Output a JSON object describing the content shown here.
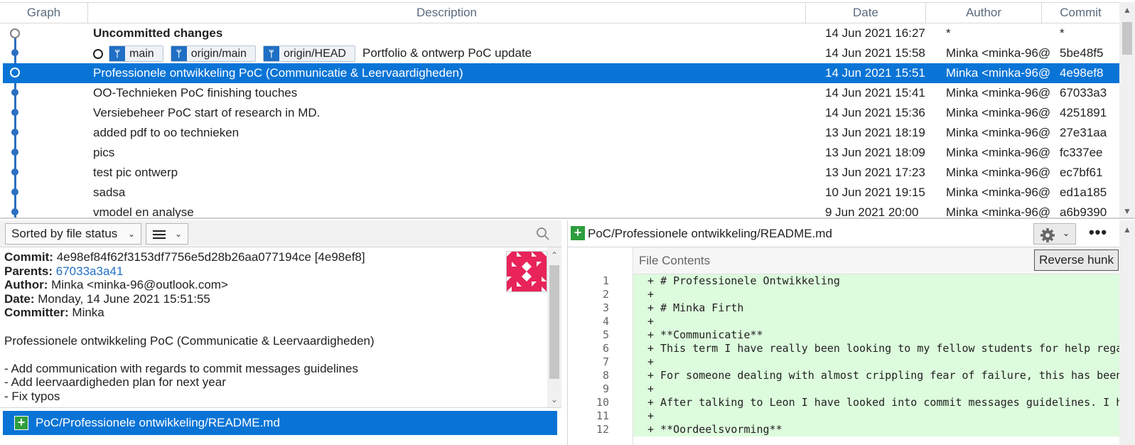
{
  "table": {
    "columns": [
      "Graph",
      "Description",
      "Date",
      "Author",
      "Commit"
    ],
    "commits": [
      {
        "description": "Uncommitted changes",
        "date": "14 Jun 2021 16:27",
        "author": "*",
        "commit": "*"
      },
      {
        "refs": [
          "main",
          "origin/main",
          "origin/HEAD"
        ],
        "description": "Portfolio & ontwerp PoC update",
        "date": "14 Jun 2021 15:58",
        "author": "Minka <minka-96@",
        "commit": "5be48f5"
      },
      {
        "description": "Professionele ontwikkeling PoC (Communicatie & Leervaardigheden)",
        "date": "14 Jun 2021 15:51",
        "author": "Minka <minka-96@",
        "commit": "4e98ef8"
      },
      {
        "description": "OO-Technieken PoC finishing touches",
        "date": "14 Jun 2021 15:41",
        "author": "Minka <minka-96@",
        "commit": "67033a3"
      },
      {
        "description": "Versiebeheer PoC start of research in MD.",
        "date": "14 Jun 2021 15:36",
        "author": "Minka <minka-96@",
        "commit": "4251891"
      },
      {
        "description": "added pdf to oo technieken",
        "date": "13 Jun 2021 18:19",
        "author": "Minka <minka-96@",
        "commit": "27e31aa"
      },
      {
        "description": "pics",
        "date": "13 Jun 2021 18:09",
        "author": "Minka <minka-96@",
        "commit": "fc337ee"
      },
      {
        "description": "test pic ontwerp",
        "date": "13 Jun 2021 17:23",
        "author": "Minka <minka-96@",
        "commit": "ec7bf61"
      },
      {
        "description": "sadsa",
        "date": "10 Jun 2021 19:15",
        "author": "Minka <minka-96@",
        "commit": "ed1a185"
      },
      {
        "description": "vmodel en analyse",
        "date": "9 Jun 2021 20:00",
        "author": "Minka <minka-96@",
        "commit": "a6b9390"
      }
    ]
  },
  "left_panel": {
    "sort_label": "Sorted by file status",
    "details": {
      "commit_label": "Commit:",
      "commit_value": "4e98ef84f62f3153df7756e5d28b26aa077194ce [4e98ef8]",
      "parents_label": "Parents:",
      "parents_value": "67033a3a41",
      "author_label": "Author:",
      "author_value": "Minka <minka-96@outlook.com>",
      "date_label": "Date:",
      "date_value": "Monday, 14 June 2021 15:51:55",
      "committer_label": "Committer:",
      "committer_value": "Minka",
      "message_title": "Professionele ontwikkeling PoC (Communicatie & Leervaardigheden)",
      "message_lines": [
        "- Add communication with regards to commit messages guidelines",
        "- Add leervaardigheden plan for next year",
        "- Fix typos"
      ]
    },
    "file": "PoC/Professionele ontwikkeling/README.md"
  },
  "right_panel": {
    "path": "PoC/Professionele ontwikkeling/README.md",
    "file_contents_label": "File Contents",
    "reverse_hunk": "Reverse hunk",
    "more": "•••",
    "lines": [
      {
        "n": "1",
        "t": "+ # Professionele Ontwikkeling"
      },
      {
        "n": "2",
        "t": "+"
      },
      {
        "n": "3",
        "t": "+ # Minka Firth"
      },
      {
        "n": "4",
        "t": "+"
      },
      {
        "n": "5",
        "t": "+ **Communicatie**"
      },
      {
        "n": "6",
        "t": "+ This term I have really been looking to my fellow students for help rega"
      },
      {
        "n": "7",
        "t": "+"
      },
      {
        "n": "8",
        "t": "+ For someone dealing with almost crippling fear of failure, this has been"
      },
      {
        "n": "9",
        "t": "+"
      },
      {
        "n": "10",
        "t": "+ After talking to Leon I have looked into commit messages guidelines. I h"
      },
      {
        "n": "11",
        "t": "+"
      },
      {
        "n": "12",
        "t": "+ **Oordeelsvorming**"
      }
    ]
  },
  "colors": {
    "selection": "#0a74d6",
    "graph": "#2b70c0",
    "added_bg": "#ddfbdd",
    "add_icon": "#2e9e3e"
  }
}
